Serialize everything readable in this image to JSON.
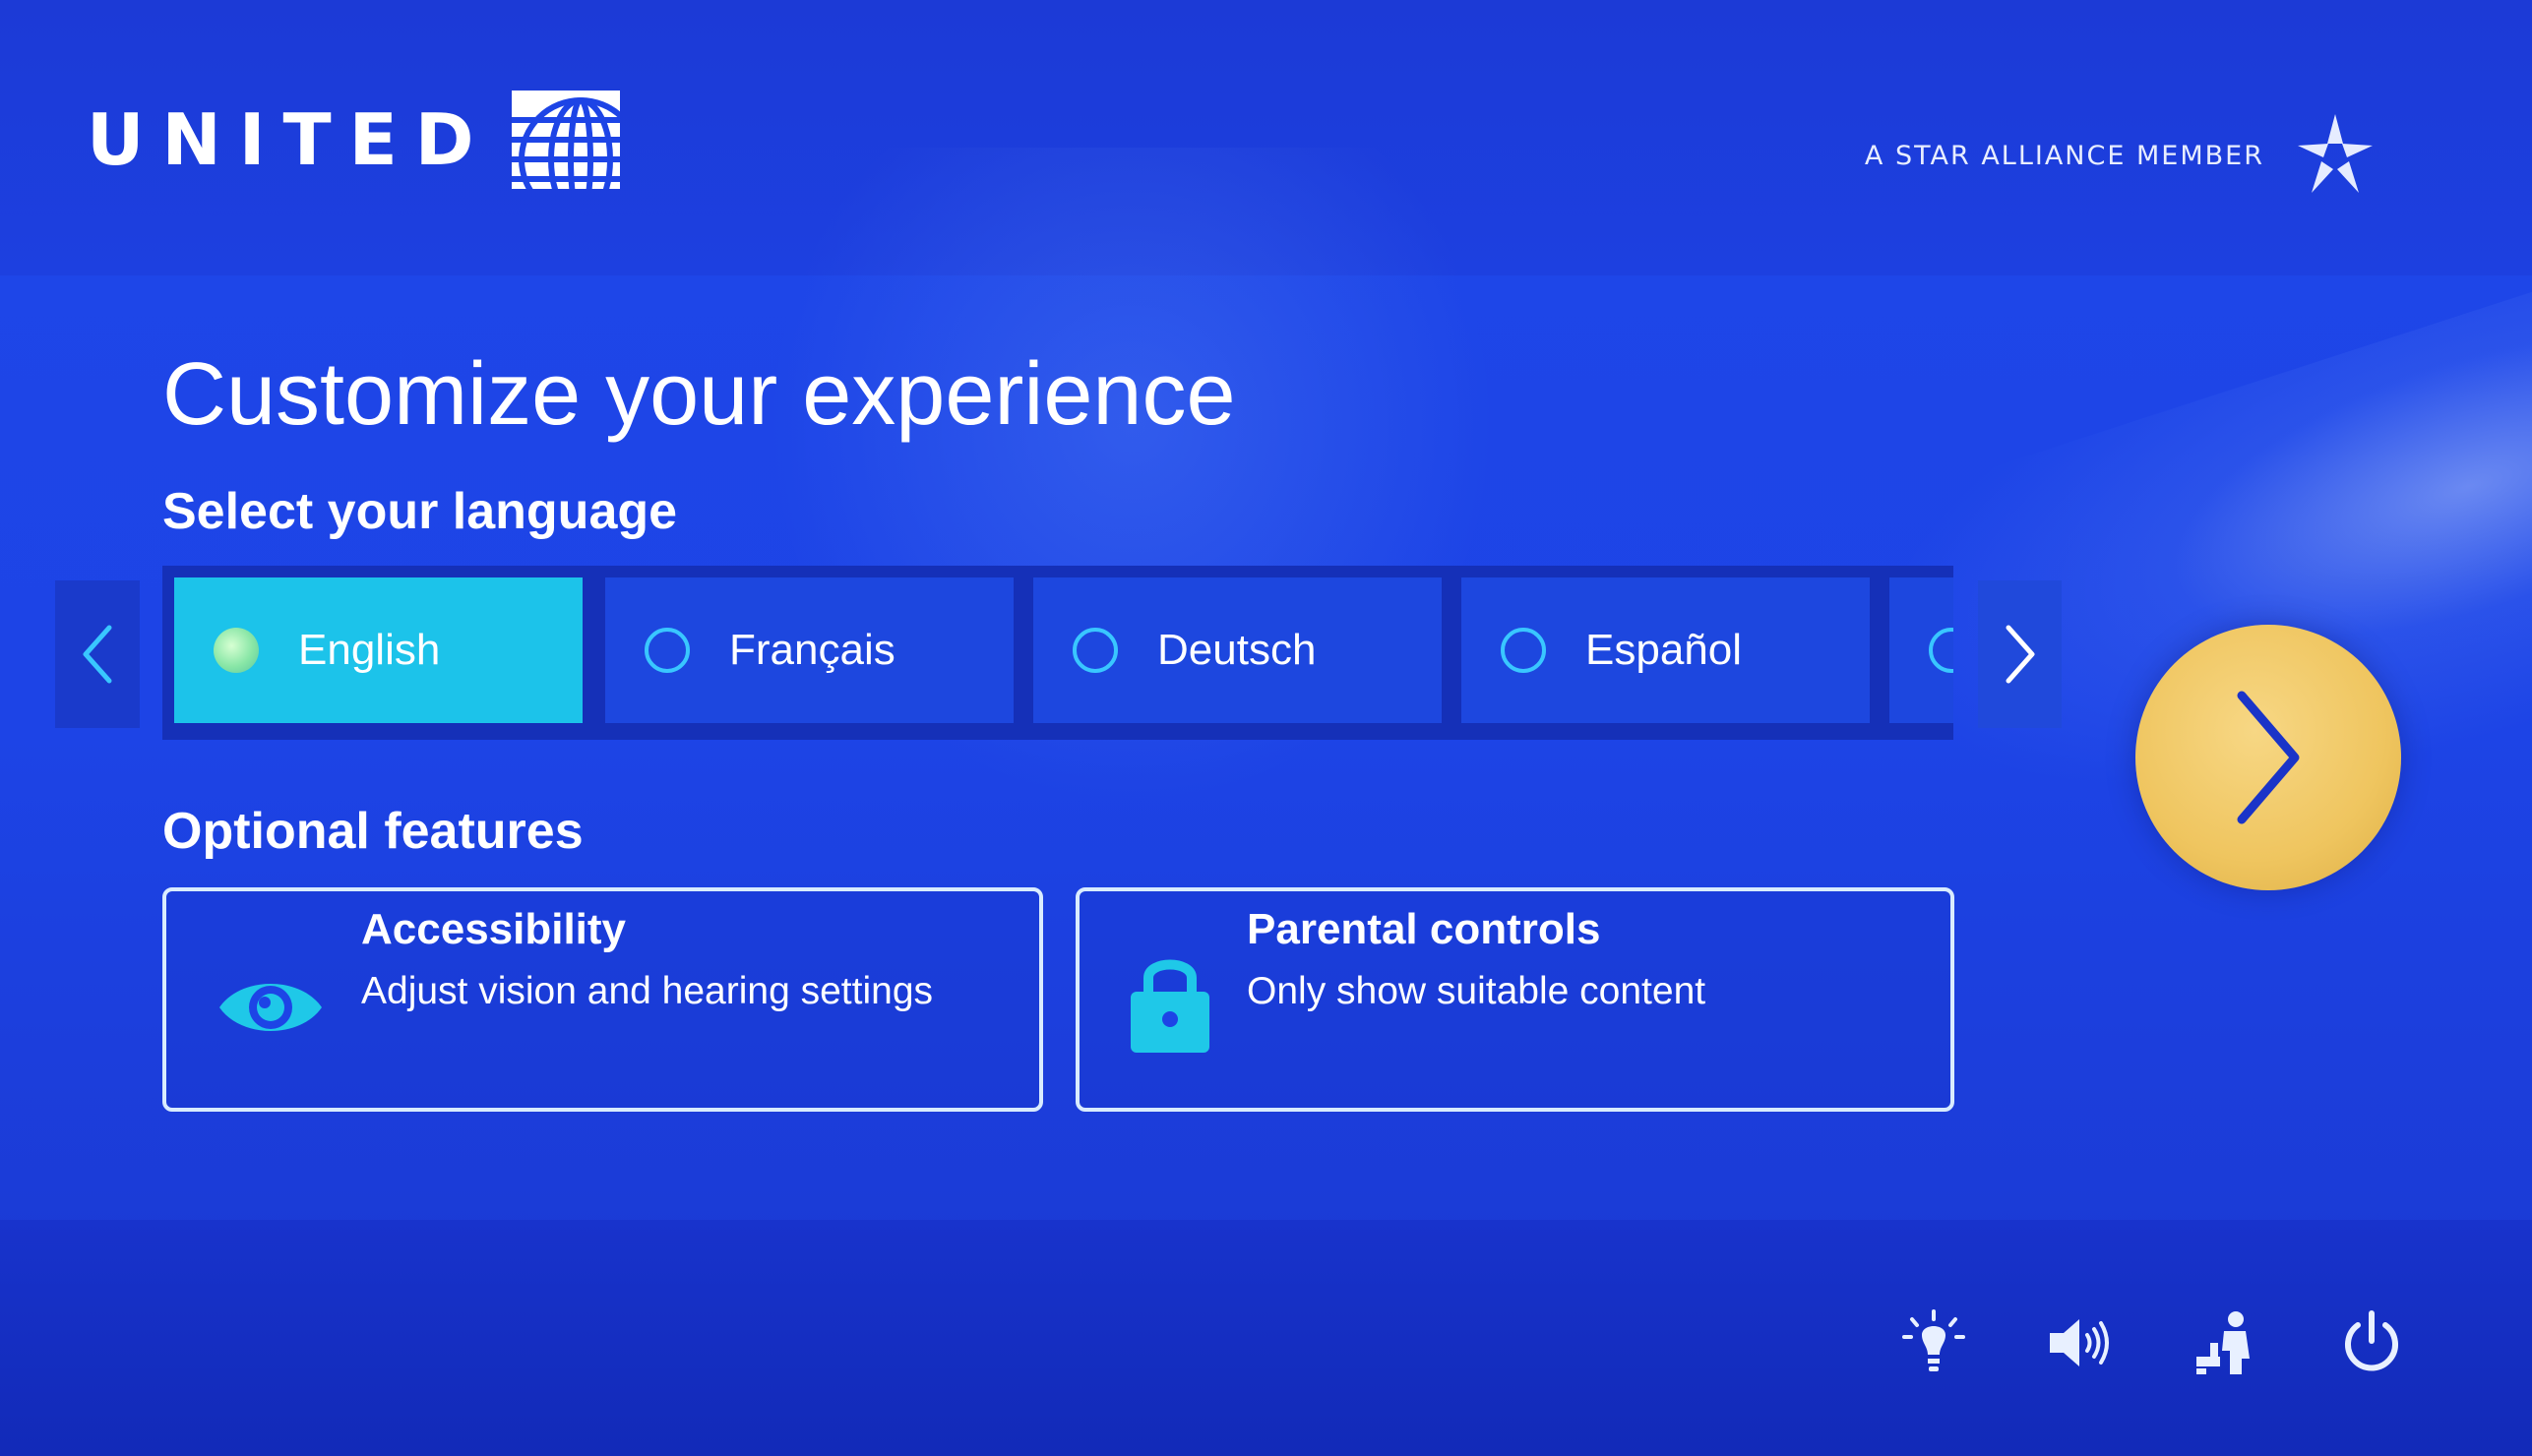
{
  "header": {
    "brand": "UNITED",
    "alliance_text": "A STAR ALLIANCE MEMBER"
  },
  "page": {
    "title": "Customize your experience"
  },
  "language": {
    "section_title": "Select your language",
    "options": [
      {
        "label": "English",
        "selected": true
      },
      {
        "label": "Français",
        "selected": false
      },
      {
        "label": "Deutsch",
        "selected": false
      },
      {
        "label": "Español",
        "selected": false
      }
    ]
  },
  "features": {
    "section_title": "Optional features",
    "cards": [
      {
        "title": "Accessibility",
        "description": "Adjust vision and hearing settings",
        "icon": "eye-icon"
      },
      {
        "title": "Parental controls",
        "description": "Only show suitable content",
        "icon": "lock-icon"
      }
    ]
  },
  "controls": {
    "icons": [
      "reading-light-icon",
      "volume-icon",
      "call-attendant-icon",
      "power-icon"
    ]
  },
  "colors": {
    "background": "#1d44e6",
    "selected_option": "#1cc3ea",
    "next_button": "#efc55f",
    "accent_cyan": "#1fc8e8"
  }
}
